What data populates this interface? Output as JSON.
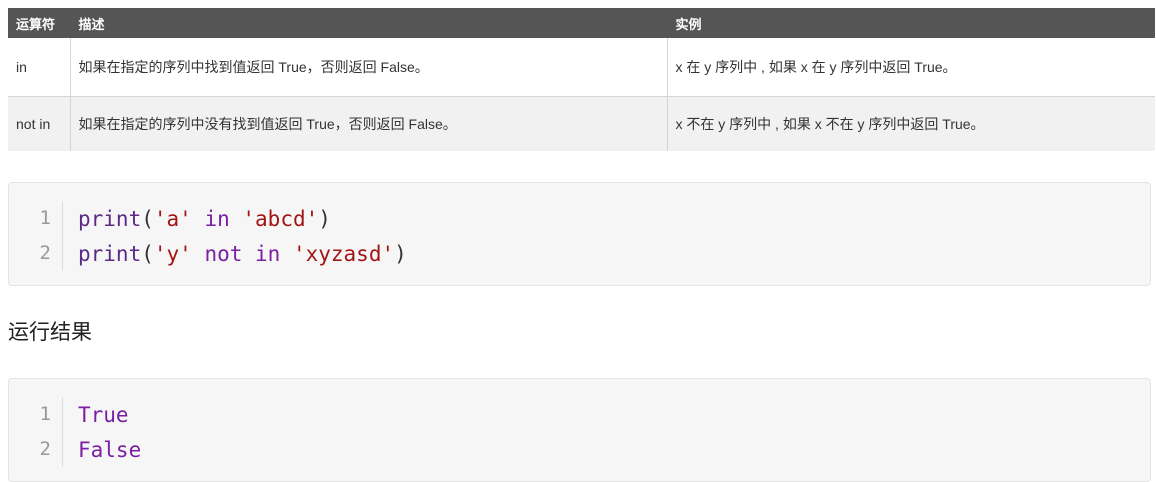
{
  "table": {
    "headers": [
      "运算符",
      "描述",
      "实例"
    ],
    "rows": [
      {
        "operator": "in",
        "description": "如果在指定的序列中找到值返回 True，否则返回 False。",
        "example": "x 在 y 序列中 , 如果 x 在 y 序列中返回 True。"
      },
      {
        "operator": "not in",
        "description": "如果在指定的序列中没有找到值返回 True，否则返回 False。",
        "example": "x 不在 y 序列中 , 如果 x 不在 y 序列中返回 True。"
      }
    ]
  },
  "code": {
    "lines": [
      {
        "number": "1",
        "func": "print",
        "open": "(",
        "str1": "'a'",
        "kw": " in ",
        "str2": "'abcd'",
        "close": ")"
      },
      {
        "number": "2",
        "func": "print",
        "open": "(",
        "str1": "'y'",
        "kw": " not in ",
        "str2": "'xyzasd'",
        "close": ")"
      }
    ]
  },
  "result_label": "运行结果",
  "output": {
    "lines": [
      {
        "number": "1",
        "text": "True"
      },
      {
        "number": "2",
        "text": "False"
      }
    ]
  },
  "colors": {
    "header_bg": "#555555",
    "string": "#a31515",
    "keyword": "#7a1fa2",
    "function": "#5b2a86"
  }
}
